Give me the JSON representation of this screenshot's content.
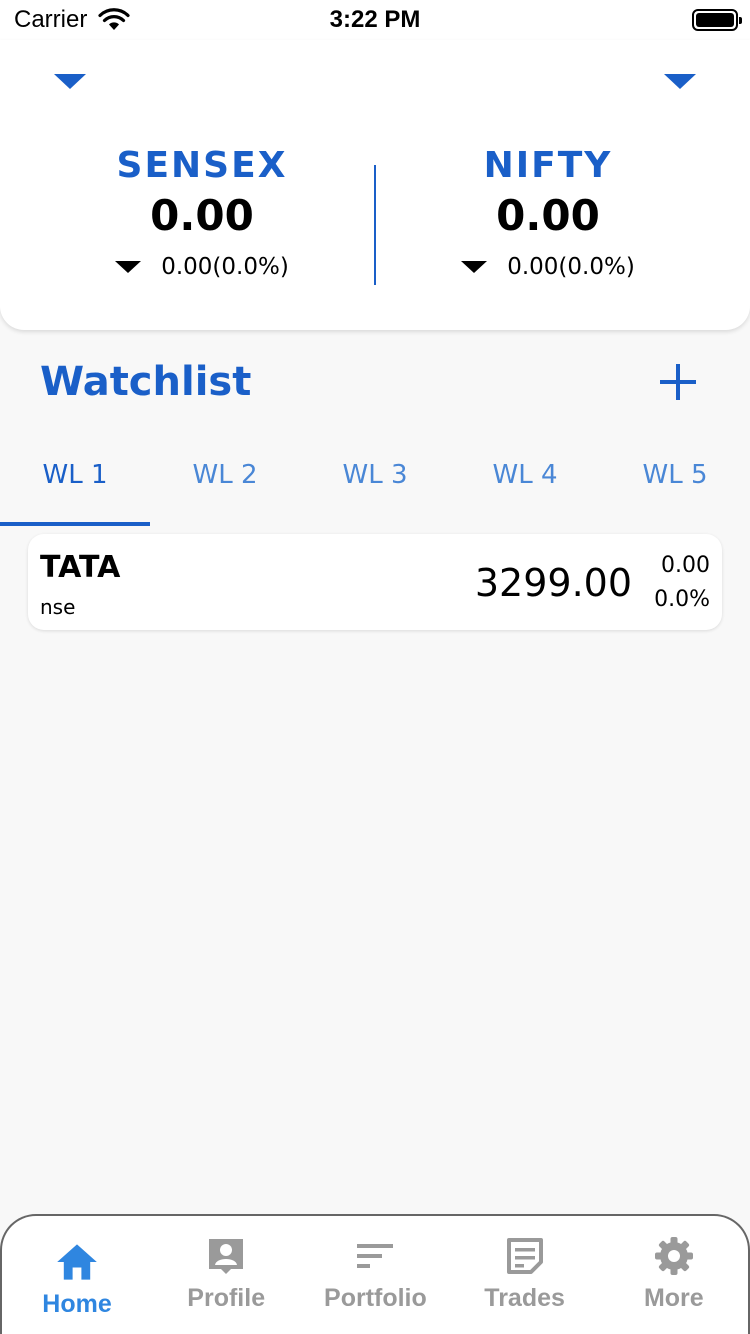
{
  "status_bar": {
    "carrier": "Carrier",
    "time": "3:22 PM"
  },
  "indices": [
    {
      "name": "SENSEX",
      "value": "0.00",
      "change": "0.00(0.0%)",
      "direction": "down"
    },
    {
      "name": "NIFTY",
      "value": "0.00",
      "change": "0.00(0.0%)",
      "direction": "down"
    }
  ],
  "watchlist": {
    "title": "Watchlist",
    "tabs": [
      "WL 1",
      "WL 2",
      "WL 3",
      "WL 4",
      "WL 5"
    ],
    "active_tab": "WL 1",
    "items": [
      {
        "symbol": "TATA",
        "exchange": "nse",
        "price": "3299.00",
        "change": "0.00",
        "change_pct": "0.0%"
      }
    ]
  },
  "bottom_nav": {
    "items": [
      {
        "label": "Home",
        "icon": "home-icon",
        "active": true
      },
      {
        "label": "Profile",
        "icon": "profile-icon",
        "active": false
      },
      {
        "label": "Portfolio",
        "icon": "sort-icon",
        "active": false
      },
      {
        "label": "Trades",
        "icon": "note-icon",
        "active": false
      },
      {
        "label": "More",
        "icon": "gear-icon",
        "active": false
      }
    ]
  },
  "colors": {
    "accent": "#1a5fc8",
    "tab_inactive": "#4a87d6",
    "nav_active": "#2f86e0",
    "nav_inactive": "#9a9a9a"
  }
}
